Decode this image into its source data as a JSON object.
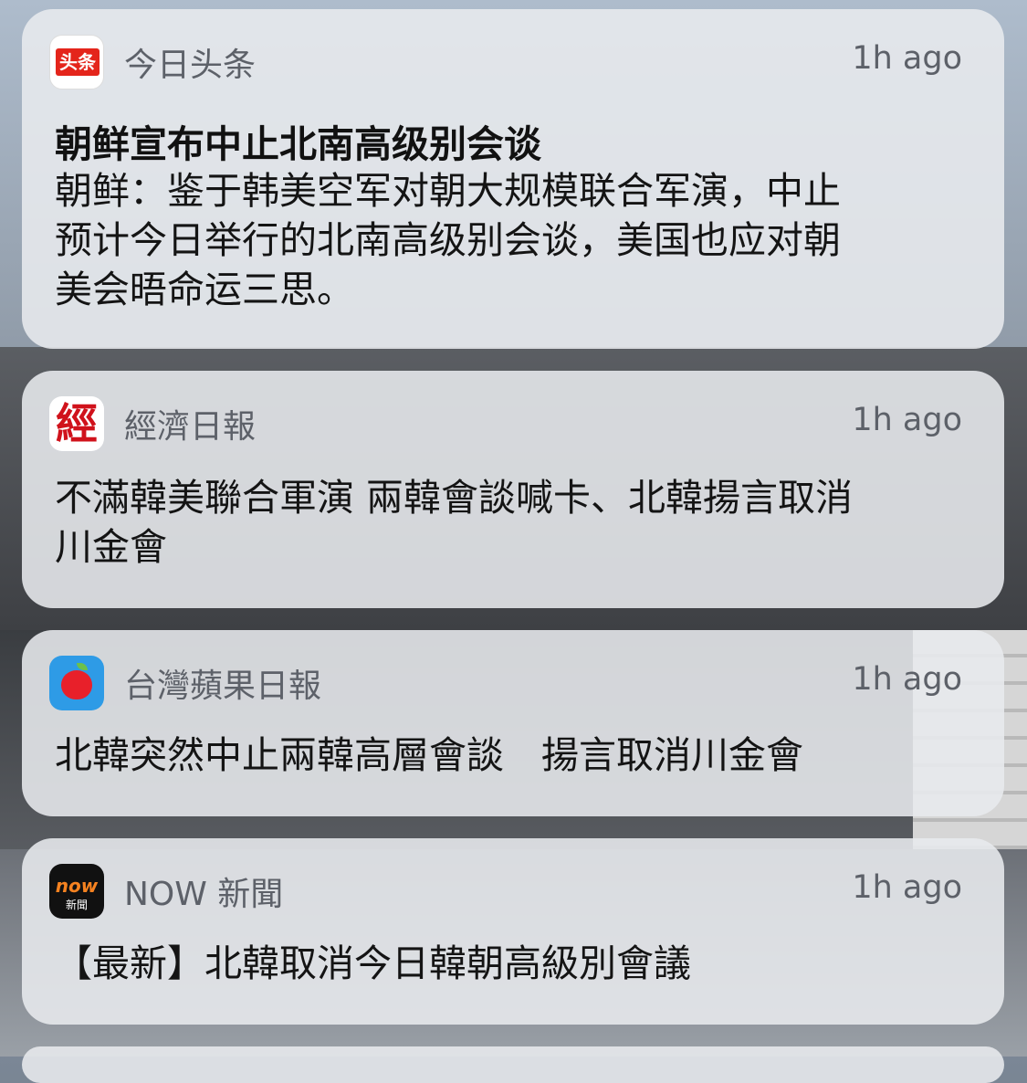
{
  "notifications": [
    {
      "app_name": "今日头条",
      "icon": "toutiao-app-icon",
      "icon_text": "头条",
      "time": "1h ago",
      "title": "朝鲜宣布中止北南高级别会谈",
      "body_lines": [
        "朝鲜：鉴于韩美空军对朝大规模联合军演，中止",
        "预计今日举行的北南高级别会谈，美国也应对朝",
        "美会晤命运三思。"
      ]
    },
    {
      "app_name": "經濟日報",
      "icon": "hket-app-icon",
      "icon_text": "經",
      "time": "1h ago",
      "body_lines": [
        "不滿韓美聯合軍演 兩韓會談喊卡、北韓揚言取消",
        "川金會"
      ]
    },
    {
      "app_name": "台灣蘋果日報",
      "icon": "apple-daily-app-icon",
      "time": "1h ago",
      "body_lines": [
        "北韓突然中止兩韓高層會談　揚言取消川金會"
      ]
    },
    {
      "app_name": "NOW 新聞",
      "icon": "now-news-app-icon",
      "icon_text": "now",
      "icon_subtext": "新聞",
      "time": "1h ago",
      "body_lines": [
        "【最新】北韓取消今日韓朝高級別會議"
      ]
    }
  ],
  "colors": {
    "card_bg": "#e8eaee",
    "secondary_text": "#5d6169",
    "primary_text": "#111111",
    "toutiao_red": "#e4251b",
    "apple_blue": "#2e9be6",
    "now_orange": "#f58220"
  }
}
